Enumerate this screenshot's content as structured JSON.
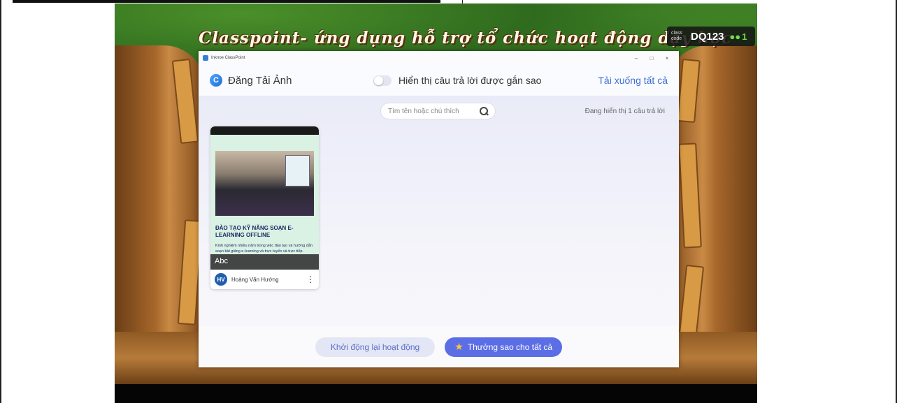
{
  "slide": {
    "title": "Classpoint- ứng dụng hỗ trợ tổ chức hoạt động dạy học",
    "class_code_label": "class code",
    "class_code": "DQ123",
    "participants": "1"
  },
  "window": {
    "app_title": "Inknoe ClassPoint",
    "minimize": "–",
    "maximize": "□",
    "close": "×"
  },
  "header": {
    "logo_letter": "C",
    "title": "Đăng Tải Ảnh",
    "toggle_label": "Hiển thị câu trả lời được gắn sao",
    "toggle_on": false,
    "download_all": "Tải xuống tất cả"
  },
  "content": {
    "search_placeholder": "Tìm tên hoặc chú thích",
    "showing_count": "Đang hiển thị 1 câu trả lời",
    "cards": [
      {
        "heading": "ĐÀO TẠO KỸ NĂNG SOẠN E-LEARNING OFFLINE",
        "description": "Kinh nghiệm nhiều năm trong việc đào tạo và hướng dẫn soạn bài giảng e-learning và trực tuyến và trực tiếp.",
        "caption": "Abc",
        "avatar_initials": "HV",
        "student_name": "Hoàng Văn Hướng",
        "more": "⋮"
      }
    ]
  },
  "footer": {
    "restart_label": "Khởi động lại hoạt động",
    "star_all_label": "Thưởng sao cho tất cả"
  },
  "icons": {
    "search": "search-icon",
    "star": "star-icon",
    "participants": "users-icon",
    "more": "more-vertical-icon"
  },
  "colors": {
    "accent": "#5b6ee6",
    "link": "#3b6fd8",
    "avatar": "#1f5fae"
  }
}
